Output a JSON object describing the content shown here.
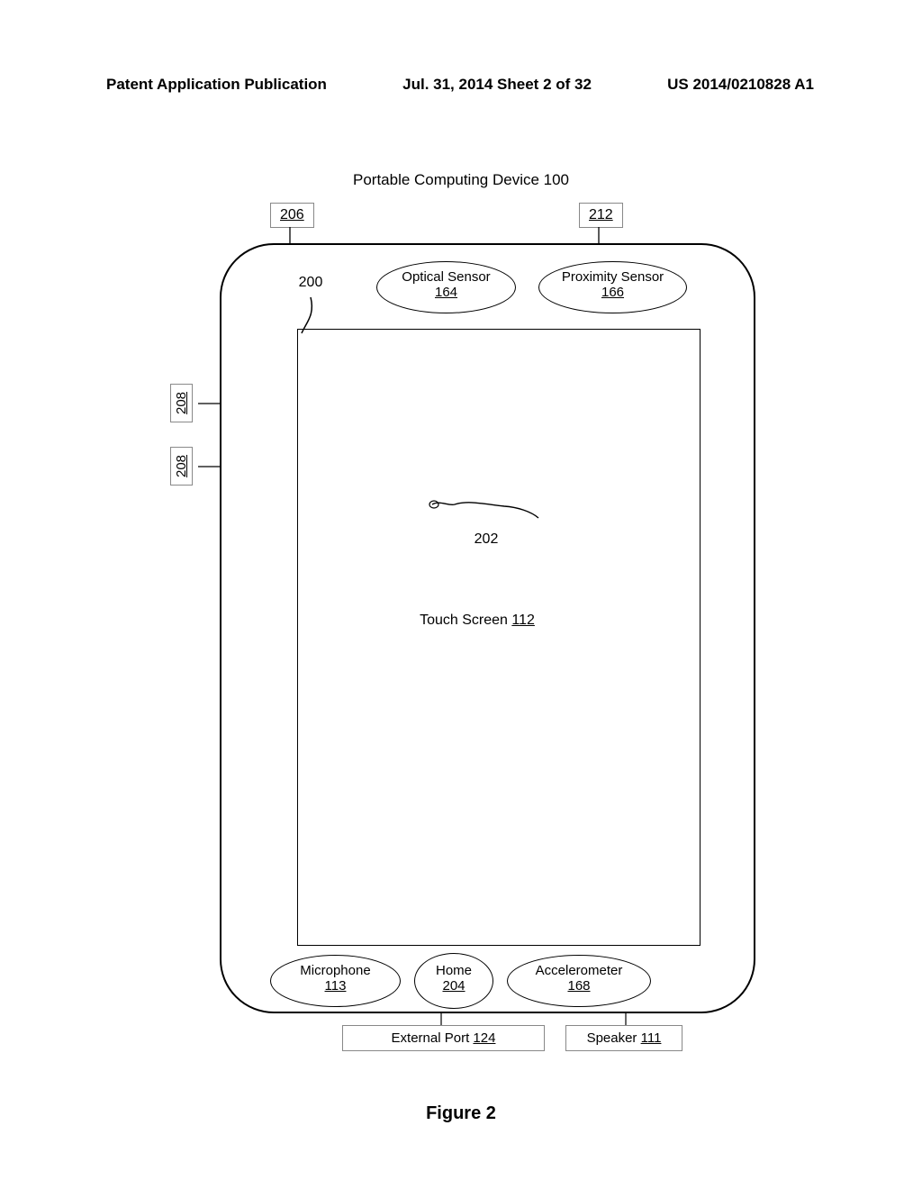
{
  "header": {
    "left": "Patent Application Publication",
    "center": "Jul. 31, 2014  Sheet 2 of 32",
    "right": "US 2014/0210828 A1"
  },
  "title": "Portable Computing Device 100",
  "refs": {
    "top_left_box": "206",
    "top_right_box": "212",
    "side_upper": "208",
    "side_lower": "208",
    "corner_200": "200",
    "finger_202": "202"
  },
  "bubbles": {
    "optical": {
      "label": "Optical Sensor",
      "num": "164"
    },
    "proximity": {
      "label": "Proximity Sensor",
      "num": "166"
    },
    "microphone": {
      "label": "Microphone",
      "num": "113"
    },
    "home": {
      "label": "Home",
      "num": "204"
    },
    "accel": {
      "label": "Accelerometer",
      "num": "168"
    }
  },
  "touchscreen": {
    "label": "Touch Screen ",
    "num": "112"
  },
  "bottom": {
    "external_port": {
      "label": "External Port ",
      "num": "124"
    },
    "speaker": {
      "label": "Speaker ",
      "num": "111"
    }
  },
  "figure": "Figure 2"
}
